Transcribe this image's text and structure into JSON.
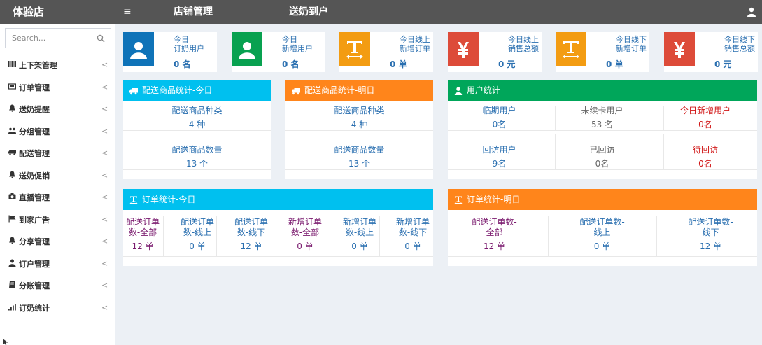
{
  "header": {
    "brand": "体验店",
    "menu_icon": "≡",
    "nav": [
      "店铺管理",
      "送奶到户"
    ]
  },
  "search": {
    "placeholder": "Search..."
  },
  "sidebar": {
    "items": [
      {
        "label": "上下架管理",
        "icon": "barcode-icon"
      },
      {
        "label": "订单管理",
        "icon": "ticket-icon"
      },
      {
        "label": "送奶提醒",
        "icon": "bell-icon"
      },
      {
        "label": "分组管理",
        "icon": "users-icon"
      },
      {
        "label": "配送管理",
        "icon": "truck-icon"
      },
      {
        "label": "送奶促销",
        "icon": "bell-icon"
      },
      {
        "label": "直播管理",
        "icon": "camera-icon"
      },
      {
        "label": "到家广告",
        "icon": "flag-icon"
      },
      {
        "label": "分享管理",
        "icon": "bell-icon"
      },
      {
        "label": "订户管理",
        "icon": "user-icon"
      },
      {
        "label": "分账管理",
        "icon": "book-icon"
      },
      {
        "label": "订奶统计",
        "icon": "signal-icon"
      }
    ],
    "chevron": "<"
  },
  "stat_boxes": [
    {
      "title1": "今日",
      "title2": "订奶用户",
      "value": "0 名",
      "color": "#0f73b8",
      "icon": "user-icon"
    },
    {
      "title1": "今日",
      "title2": "新增用户",
      "value": "0 名",
      "color": "#08a150",
      "icon": "user-icon"
    },
    {
      "title1": "今日线上",
      "title2": "新增订单",
      "value": "0 单",
      "color": "#f39c12",
      "icon": "text-width-icon"
    },
    {
      "title1": "今日线上",
      "title2": "销售总额",
      "value": "0 元",
      "color": "#dd4b39",
      "icon": "yen-icon"
    },
    {
      "title1": "今日线下",
      "title2": "新增订单",
      "value": "0 单",
      "color": "#f39c12",
      "icon": "text-width-icon"
    },
    {
      "title1": "今日线下",
      "title2": "销售总额",
      "value": "0 元",
      "color": "#dd4b39",
      "icon": "yen-icon"
    }
  ],
  "delivery_today": {
    "title": "配送商品统计-今日",
    "color": "#00c0ef",
    "rows": [
      {
        "label": "配送商品种类",
        "value": "4 种"
      },
      {
        "label": "配送商品数量",
        "value": "13 个"
      }
    ]
  },
  "delivery_tomorrow": {
    "title": "配送商品统计-明日",
    "color": "#ff851b",
    "rows": [
      {
        "label": "配送商品种类",
        "value": "4 种"
      },
      {
        "label": "配送商品数量",
        "value": "13 个"
      }
    ]
  },
  "user_stats": {
    "title": "用户统计",
    "color": "#00a65a",
    "cells": [
      {
        "label": "临期用户",
        "value": "0名"
      },
      {
        "label": "未续卡用户",
        "value": "53 名"
      },
      {
        "label": "今日新增用户",
        "value": "0名"
      },
      {
        "label": "回访用户",
        "value": "9名"
      },
      {
        "label": "已回访",
        "value": "0名"
      },
      {
        "label": "待回访",
        "value": "0名"
      }
    ]
  },
  "orders_today": {
    "title": "订单统计-今日",
    "color": "#00c0ef",
    "cells": [
      {
        "label1": "配送订单",
        "label2": "数-全部",
        "value": "12 单"
      },
      {
        "label1": "配送订单",
        "label2": "数-线上",
        "value": "0 单"
      },
      {
        "label1": "配送订单",
        "label2": "数-线下",
        "value": "12 单"
      },
      {
        "label1": "新增订单",
        "label2": "数-全部",
        "value": "0 单"
      },
      {
        "label1": "新增订单",
        "label2": "数-线上",
        "value": "0 单"
      },
      {
        "label1": "新增订单",
        "label2": "数-线下",
        "value": "0 单"
      }
    ]
  },
  "orders_tomorrow": {
    "title": "订单统计-明日",
    "color": "#ff851b",
    "cells": [
      {
        "label1": "配送订单数-",
        "label2": "全部",
        "value": "12 单"
      },
      {
        "label1": "配送订单数-",
        "label2": "线上",
        "value": "0 单"
      },
      {
        "label1": "配送订单数-",
        "label2": "线下",
        "value": "12 单"
      }
    ]
  }
}
